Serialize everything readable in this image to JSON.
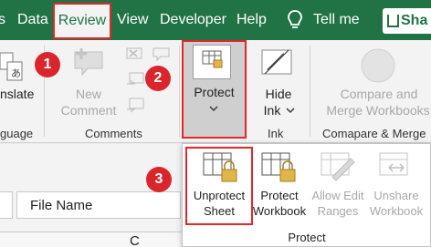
{
  "tabs": {
    "s": "s",
    "data": "Data",
    "review": "Review",
    "view": "View",
    "developer": "Developer",
    "help": "Help",
    "tell_me": "Tell me",
    "share": "Sha"
  },
  "ribbon": {
    "translate_label": "nslate",
    "language_group": "guage",
    "new_comment_line1": "New",
    "new_comment_line2": "Comment",
    "comments_group": "Comments",
    "protect_label": "Protect",
    "hide_ink_line1": "Hide",
    "hide_ink_line2": "Ink",
    "ink_group": "Ink",
    "compare_line1": "Compare and",
    "compare_line2": "Merge Workbooks",
    "compare_group": "Comapare & Merge"
  },
  "badges": {
    "one": "1",
    "two": "2",
    "three": "3"
  },
  "formula_bar": {
    "name_box": "File Name",
    "column_c": "C"
  },
  "protect_menu": {
    "unprotect_line1": "Unprotect",
    "unprotect_line2": "Sheet",
    "protect_wb_line1": "Protect",
    "protect_wb_line2": "Workbook",
    "allow_edit_line1": "Allow Edit",
    "allow_edit_line2": "Ranges",
    "unshare_line1": "Unshare",
    "unshare_line2": "Workbook",
    "group_label": "Protect"
  },
  "colors": {
    "excel_green": "#217346",
    "highlight_red": "#e3262a",
    "badge_red": "#d9252b"
  },
  "icons": [
    "lightbulb-icon",
    "share-icon",
    "translate-icon",
    "new-comment-icon",
    "delete-comment-icon",
    "previous-comment-icon",
    "next-comment-icon",
    "show-comments-icon",
    "protect-icon",
    "hide-ink-icon",
    "compare-merge-icon",
    "unprotect-sheet-icon",
    "protect-workbook-icon",
    "allow-edit-ranges-icon",
    "unshare-workbook-icon"
  ]
}
